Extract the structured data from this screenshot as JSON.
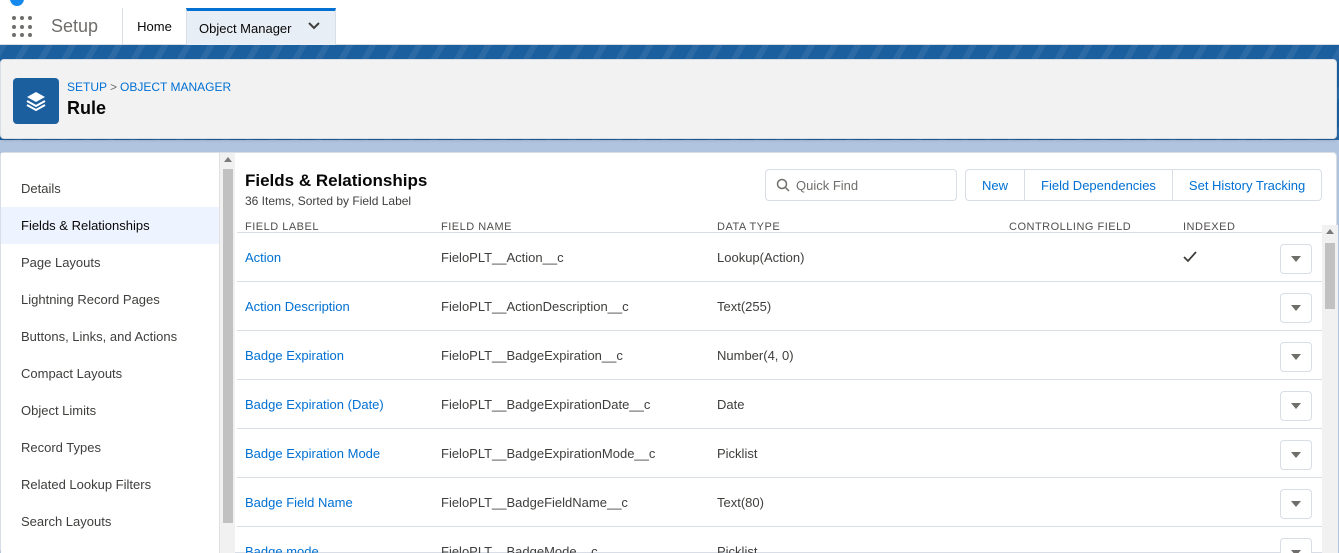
{
  "nav": {
    "app_name": "Setup",
    "tabs": [
      {
        "label": "Home"
      },
      {
        "label": "Object Manager"
      }
    ]
  },
  "page_header": {
    "breadcrumb": [
      "SETUP",
      "OBJECT MANAGER"
    ],
    "breadcrumb_sep": ">",
    "title": "Rule",
    "icon": "layers-icon"
  },
  "sidebar": {
    "items": [
      {
        "label": "Details"
      },
      {
        "label": "Fields & Relationships",
        "active": true
      },
      {
        "label": "Page Layouts"
      },
      {
        "label": "Lightning Record Pages"
      },
      {
        "label": "Buttons, Links, and Actions"
      },
      {
        "label": "Compact Layouts"
      },
      {
        "label": "Object Limits"
      },
      {
        "label": "Record Types"
      },
      {
        "label": "Related Lookup Filters"
      },
      {
        "label": "Search Layouts"
      }
    ]
  },
  "section": {
    "title": "Fields & Relationships",
    "subtitle": "36 Items, Sorted by Field Label",
    "search_placeholder": "Quick Find",
    "buttons": [
      "New",
      "Field Dependencies",
      "Set History Tracking"
    ]
  },
  "table": {
    "columns": [
      "FIELD LABEL",
      "FIELD NAME",
      "DATA TYPE",
      "CONTROLLING FIELD",
      "INDEXED"
    ],
    "rows": [
      {
        "label": "Action",
        "name": "FieloPLT__Action__c",
        "type": "Lookup(Action)",
        "indexed": true
      },
      {
        "label": "Action Description",
        "name": "FieloPLT__ActionDescription__c",
        "type": "Text(255)",
        "indexed": false
      },
      {
        "label": "Badge Expiration",
        "name": "FieloPLT__BadgeExpiration__c",
        "type": "Number(4, 0)",
        "indexed": false
      },
      {
        "label": "Badge Expiration (Date)",
        "name": "FieloPLT__BadgeExpirationDate__c",
        "type": "Date",
        "indexed": false
      },
      {
        "label": "Badge Expiration Mode",
        "name": "FieloPLT__BadgeExpirationMode__c",
        "type": "Picklist",
        "indexed": false
      },
      {
        "label": "Badge Field Name",
        "name": "FieloPLT__BadgeFieldName__c",
        "type": "Text(80)",
        "indexed": false
      },
      {
        "label": "Badge mode",
        "name": "FieloPLT__BadgeMode__c",
        "type": "Picklist",
        "indexed": false
      }
    ]
  },
  "colors": {
    "brand_blue": "#1b5f9e",
    "link": "#0070d2",
    "active_nav_bg": "#eef4ff"
  }
}
